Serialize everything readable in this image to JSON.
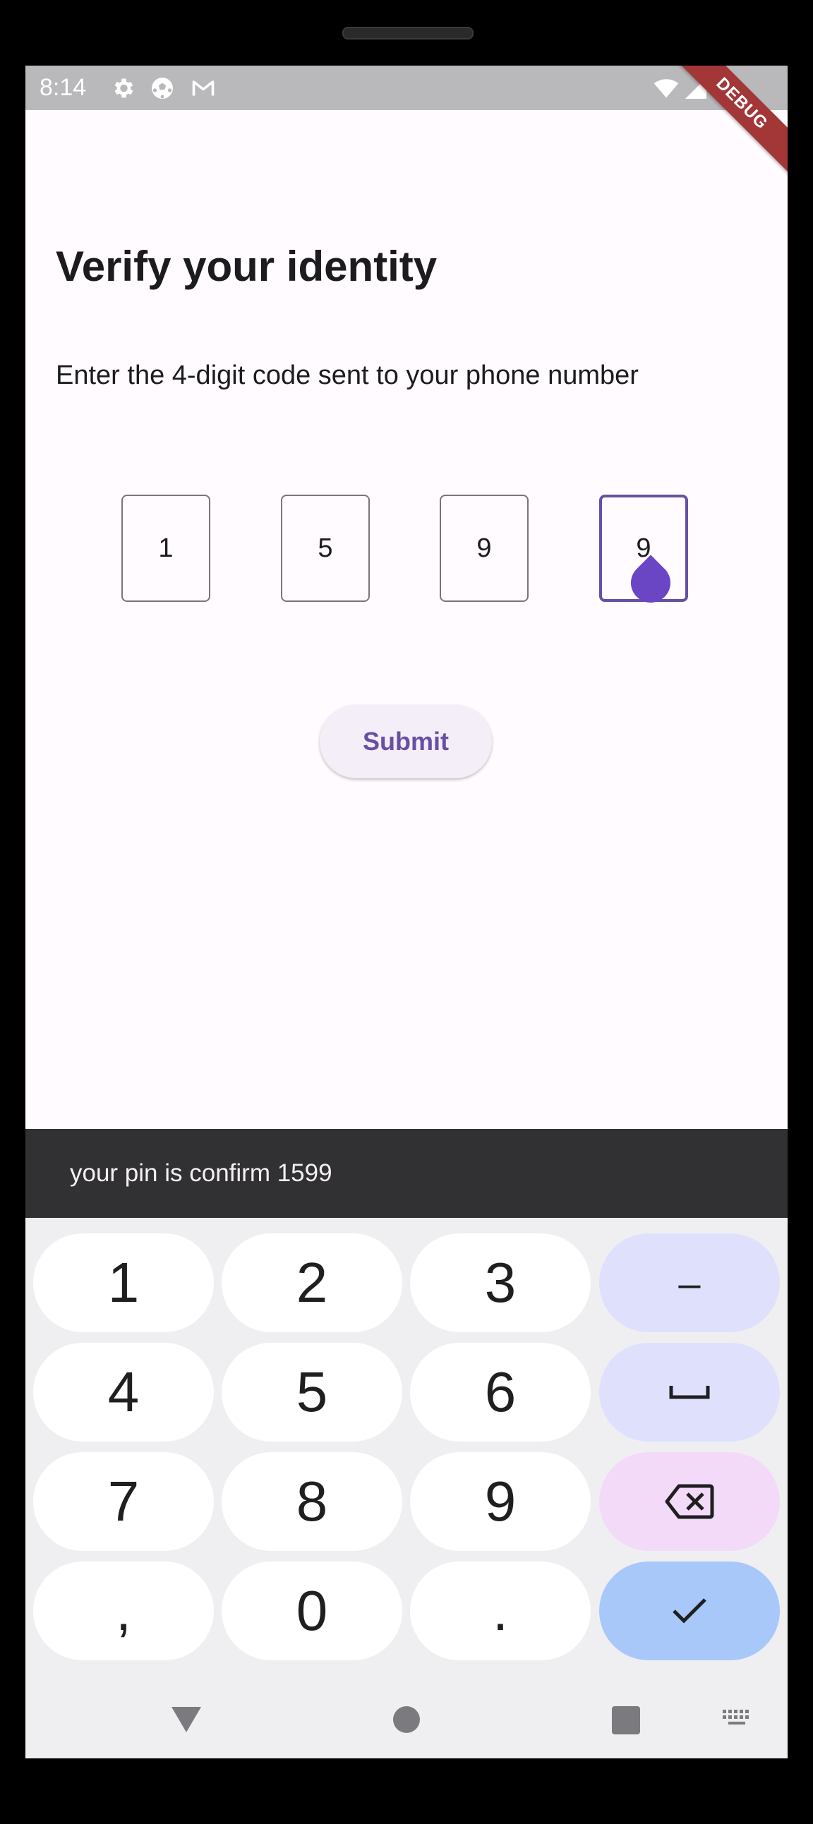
{
  "status_bar": {
    "time": "8:14",
    "left_icons": [
      "settings-icon",
      "soccer-ball-icon",
      "gmail-icon"
    ],
    "right_icons": [
      "wifi-icon",
      "signal-icon",
      "battery-icon"
    ],
    "debug_banner": "DEBUG"
  },
  "page": {
    "title": "Verify your identity",
    "subtitle": "Enter the 4-digit code sent to your phone number"
  },
  "pin": {
    "digits": [
      "1",
      "5",
      "9",
      "9"
    ],
    "focused_index": 3
  },
  "submit_button": {
    "label": "Submit"
  },
  "snackbar": {
    "message": "your pin is confirm 1599"
  },
  "keyboard": {
    "rows": [
      [
        "1",
        "2",
        "3",
        "–"
      ],
      [
        "4",
        "5",
        "6",
        "space-icon"
      ],
      [
        "7",
        "8",
        "9",
        "backspace-icon"
      ],
      [
        ",",
        "0",
        ".",
        "check-icon"
      ]
    ],
    "labels": {
      "k1": "1",
      "k2": "2",
      "k3": "3",
      "dash": "–",
      "k4": "4",
      "k5": "5",
      "k6": "6",
      "k7": "7",
      "k8": "8",
      "k9": "9",
      "comma": ",",
      "k0": "0",
      "period": "."
    }
  },
  "nav_bar": {
    "buttons": [
      "back-icon",
      "home-icon",
      "recents-icon",
      "keyboard-switch-icon"
    ]
  },
  "colors": {
    "accent": "#6750a4",
    "snackbar_bg": "#313033",
    "keyboard_bg": "#efeff2",
    "key_fn": "#dfe1fc",
    "key_delete": "#f4daf9",
    "key_confirm": "#a8c8fa",
    "status_bar": "#b9b9bb",
    "debug_ribbon": "#a33737"
  }
}
